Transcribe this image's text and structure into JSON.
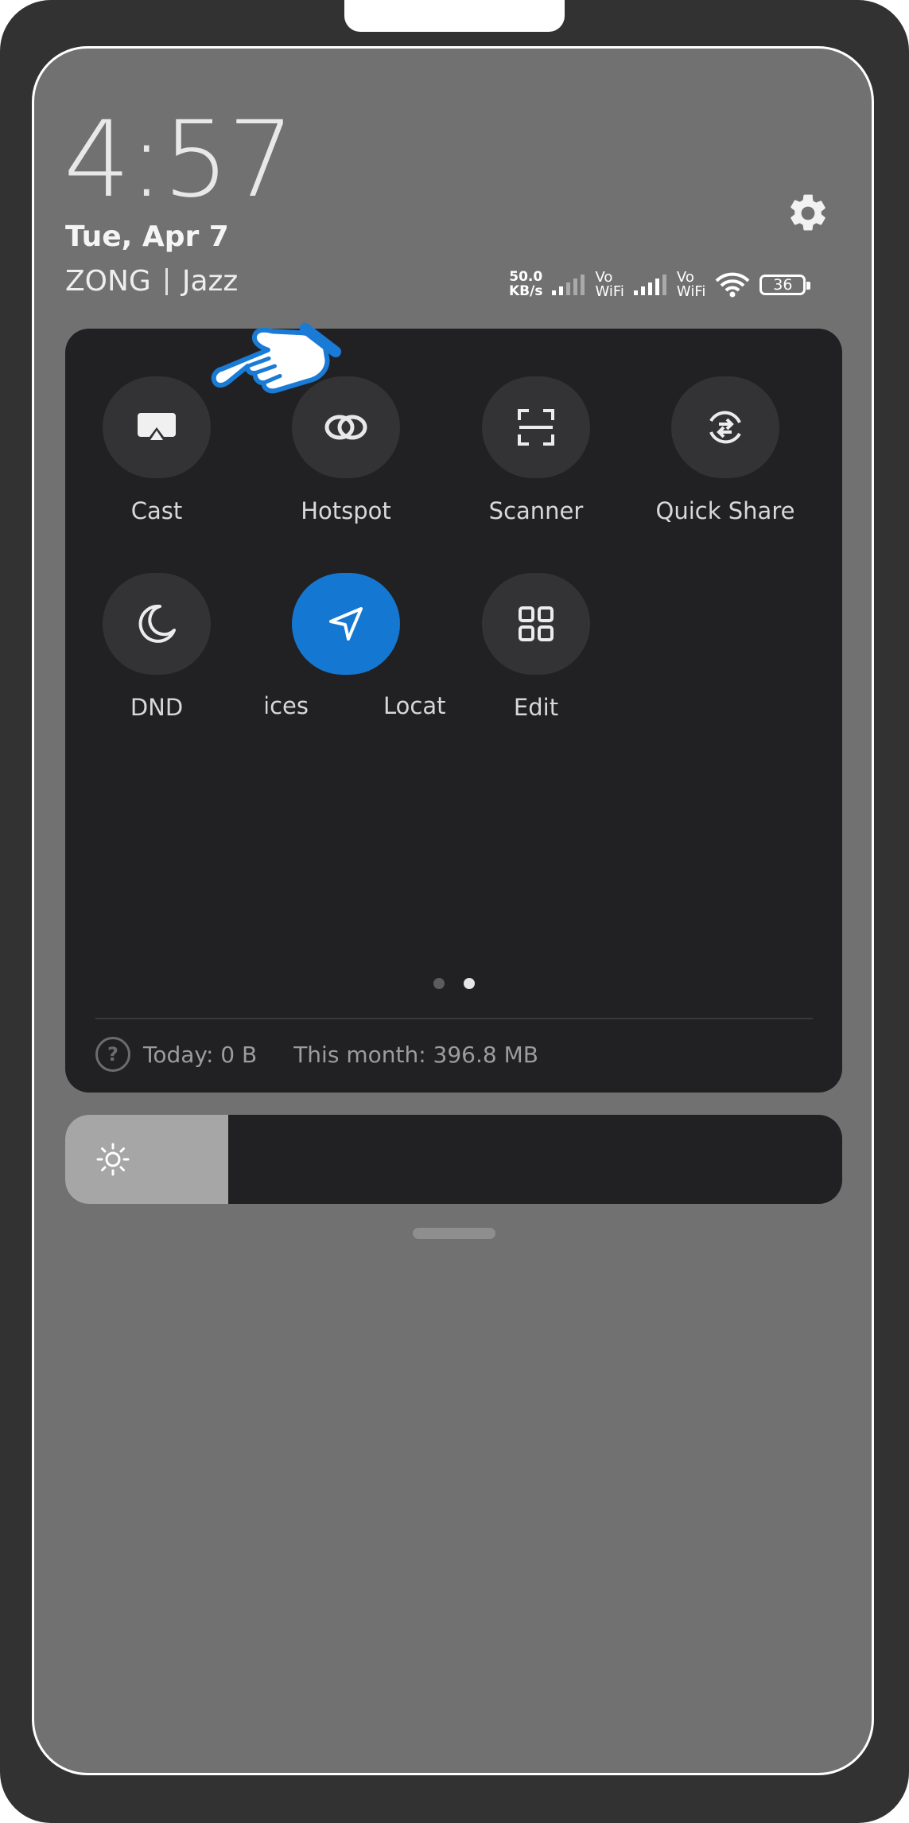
{
  "lock": {
    "time": "4:57",
    "date": "Tue, Apr 7",
    "carrier_1": "ZONG",
    "carrier_2": "Jazz"
  },
  "status": {
    "speed_value": "50.0",
    "speed_unit": "KB/s",
    "vowifi_1_top": "Vo",
    "vowifi_1_bottom": "WiFi",
    "vowifi_2_top": "Vo",
    "vowifi_2_bottom": "WiFi",
    "battery": "36"
  },
  "tiles": {
    "cast": "Cast",
    "hotspot": "Hotspot",
    "scanner": "Scanner",
    "quick_share": "Quick Share",
    "dnd": "DND",
    "devices_partial": "vices",
    "location_partial": "Locat",
    "edit": "Edit"
  },
  "pager": {
    "pages": 2,
    "current": 2
  },
  "usage": {
    "today": "Today: 0 B",
    "month": "This month: 396.8 MB"
  },
  "brightness": {
    "level": 0.21
  },
  "colors": {
    "accent": "#1478d2",
    "panel": "#212123",
    "screen": "#717171",
    "pointer": "#1a7bd6"
  },
  "icons": [
    "gear-icon",
    "cast-icon",
    "hotspot-icon",
    "scanner-icon",
    "quick-share-icon",
    "moon-icon",
    "location-arrow-icon",
    "grid-icon",
    "sun-icon",
    "help-icon",
    "pointing-hand-icon"
  ]
}
